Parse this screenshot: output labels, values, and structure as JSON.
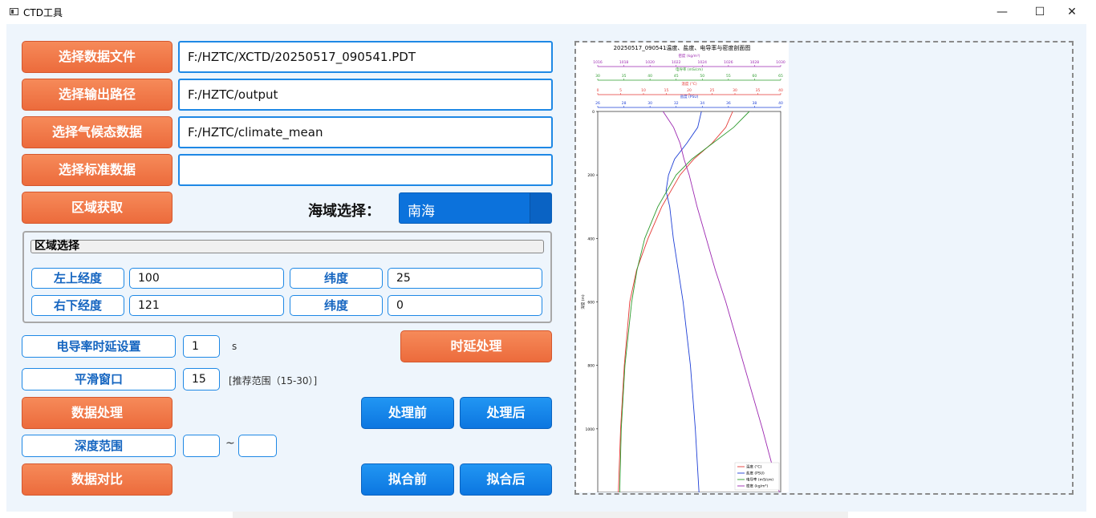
{
  "window": {
    "title": "CTD工具",
    "minimize": "—",
    "maximize": "☐",
    "close": "✕"
  },
  "files": {
    "select_data_label": "选择数据文件",
    "data_path": "F:/HZTC/XCTD/20250517_090541.PDT",
    "select_output_label": "选择输出路径",
    "output_path": "F:/HZTC/output",
    "select_climate_label": "选择气候态数据",
    "climate_path": "F:/HZTC/climate_mean",
    "select_standard_label": "选择标准数据",
    "standard_path": ""
  },
  "region": {
    "get_label": "区域获取",
    "sea_label": "海域选择：",
    "sea_value": "南海",
    "group_title": "区域选择",
    "top_left_lon_label": "左上经度",
    "top_left_lon": "100",
    "lat1_label": "纬度",
    "lat1": "25",
    "bottom_right_lon_label": "右下经度",
    "bottom_right_lon": "121",
    "lat2_label": "纬度",
    "lat2": "0"
  },
  "processing": {
    "delay_label": "电导率时延设置",
    "delay_value": "1",
    "delay_unit": "s",
    "delay_btn": "时延处理",
    "smooth_label": "平滑窗口",
    "smooth_value": "15",
    "smooth_hint": "[推荐范围（15-30）]",
    "process_btn": "数据处理",
    "before_btn": "处理前",
    "after_btn": "处理后",
    "depth_label": "深度范围",
    "depth_from": "",
    "depth_sep": "~",
    "depth_to": "",
    "compare_btn": "数据对比",
    "fit_before_btn": "拟合前",
    "fit_after_btn": "拟合后"
  },
  "chart_data": {
    "type": "line",
    "title": "20250517_090541温度、盐度、电导率与密度剖面图",
    "ylabel": "深度 (m)",
    "ylim": [
      0,
      1200
    ],
    "yticks": [
      0,
      200,
      400,
      600,
      800,
      1000
    ],
    "axes": [
      {
        "label": "密度 (kg/m³)",
        "color": "#9c27b0",
        "range": [
          1016,
          1030
        ],
        "ticks": [
          "1016",
          "1018",
          "1020",
          "1022",
          "1024",
          "1026",
          "1028",
          "1030"
        ]
      },
      {
        "label": "电导率 (mS/cm)",
        "color": "#2e9b2e",
        "range": [
          30,
          65
        ],
        "ticks": [
          "30",
          "35",
          "40",
          "45",
          "50",
          "55",
          "60",
          "65"
        ]
      },
      {
        "label": "温度 (°C)",
        "color": "#e53935",
        "range": [
          0,
          40
        ],
        "ticks": [
          "0",
          "5",
          "10",
          "15",
          "20",
          "25",
          "30",
          "35",
          "40"
        ]
      },
      {
        "label": "盐度 (PSU)",
        "color": "#1e3fd6",
        "range": [
          25,
          40
        ],
        "ticks": [
          "26",
          "28",
          "30",
          "32",
          "34",
          "36",
          "38",
          "40"
        ]
      }
    ],
    "series": [
      {
        "name": "温度 (°C)",
        "color": "#e53935",
        "axis": 2,
        "depth": [
          0,
          50,
          100,
          150,
          200,
          300,
          400,
          500,
          600,
          800,
          1000,
          1200
        ],
        "values": [
          29.5,
          28,
          25,
          21,
          18,
          14,
          11,
          8.5,
          7,
          5.8,
          5,
          4.5
        ]
      },
      {
        "name": "盐度 (PSU)",
        "color": "#1e3fd6",
        "axis": 3,
        "depth": [
          0,
          50,
          100,
          150,
          200,
          250,
          300,
          400,
          500,
          600,
          800,
          1000,
          1200
        ],
        "values": [
          33.5,
          33.2,
          32.3,
          31.3,
          30.8,
          30.6,
          30.9,
          31.2,
          31.6,
          32,
          32.6,
          33,
          33.3
        ]
      },
      {
        "name": "电导率 (mS/cm)",
        "color": "#2e9b2e",
        "axis": 1,
        "depth": [
          0,
          50,
          100,
          150,
          200,
          300,
          400,
          500,
          600,
          800,
          1000,
          1200
        ],
        "values": [
          59,
          56,
          52,
          48,
          45,
          41.5,
          39,
          37.5,
          36.5,
          35.2,
          34.5,
          34.2
        ]
      },
      {
        "name": "密度 (kg/m³)",
        "color": "#9c27b0",
        "axis": 0,
        "depth": [
          0,
          50,
          100,
          150,
          200,
          300,
          400,
          500,
          600,
          800,
          1000,
          1200
        ],
        "values": [
          1021,
          1021.8,
          1022.3,
          1022.6,
          1023,
          1023.6,
          1024.3,
          1025,
          1025.8,
          1027.2,
          1028.6,
          1029.9
        ]
      }
    ],
    "legend": "bottom-right"
  }
}
